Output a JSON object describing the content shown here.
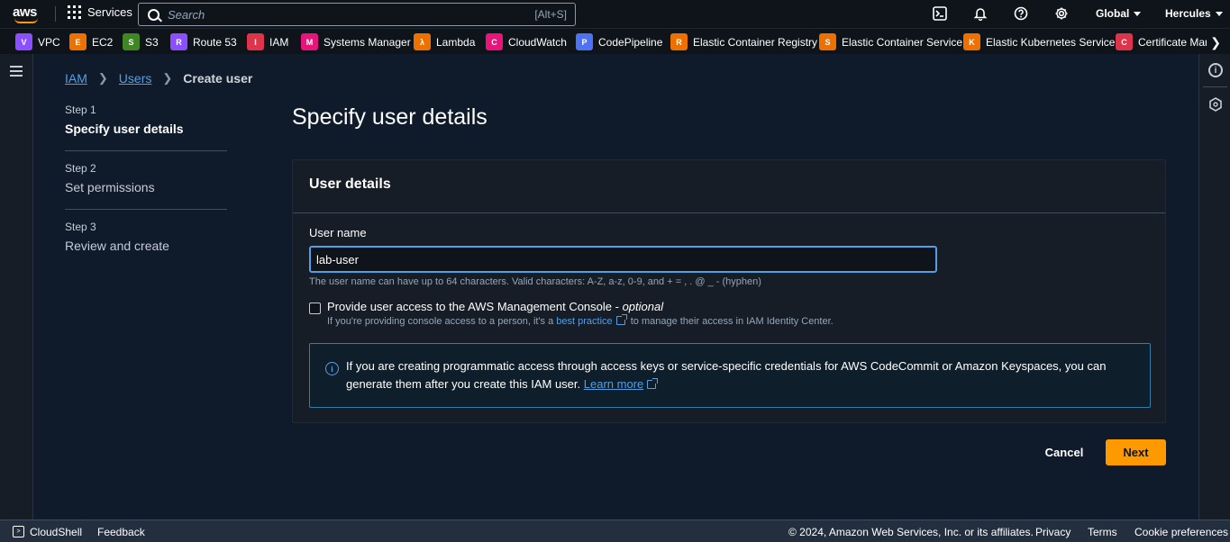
{
  "topnav": {
    "logo": "aws",
    "services_label": "Services",
    "search_placeholder": "Search",
    "search_shortcut": "[Alt+S]",
    "region": "Global",
    "account": "Hercules",
    "icons": [
      "cloudshell-icon",
      "bell-icon",
      "help-icon",
      "gear-icon"
    ]
  },
  "favorites": [
    {
      "label": "VPC",
      "color": "#8c4fff",
      "glyph": "V"
    },
    {
      "label": "EC2",
      "color": "#ed7100",
      "glyph": "E"
    },
    {
      "label": "S3",
      "color": "#3f8624",
      "glyph": "S"
    },
    {
      "label": "Route 53",
      "color": "#8c4fff",
      "glyph": "R"
    },
    {
      "label": "IAM",
      "color": "#dd344c",
      "glyph": "I"
    },
    {
      "label": "Systems Manager",
      "color": "#e7157b",
      "glyph": "M"
    },
    {
      "label": "Lambda",
      "color": "#ed7100",
      "glyph": "λ"
    },
    {
      "label": "CloudWatch",
      "color": "#e7157b",
      "glyph": "C"
    },
    {
      "label": "CodePipeline",
      "color": "#4d72f3",
      "glyph": "P"
    },
    {
      "label": "Elastic Container Registry",
      "color": "#ed7100",
      "glyph": "R"
    },
    {
      "label": "Elastic Container Service",
      "color": "#ed7100",
      "glyph": "S"
    },
    {
      "label": "Elastic Kubernetes Service",
      "color": "#ed7100",
      "glyph": "K"
    },
    {
      "label": "Certificate Man",
      "color": "#dd344c",
      "glyph": "C"
    }
  ],
  "breadcrumb": {
    "iam": "IAM",
    "users": "Users",
    "current": "Create user"
  },
  "steps": [
    {
      "num": "Step 1",
      "title": "Specify user details"
    },
    {
      "num": "Step 2",
      "title": "Set permissions"
    },
    {
      "num": "Step 3",
      "title": "Review and create"
    }
  ],
  "page_title": "Specify user details",
  "panel": {
    "header": "User details",
    "username_label": "User name",
    "username_value": "lab-user",
    "username_hint": "The user name can have up to 64 characters. Valid characters: A-Z, a-z, 0-9, and + = , . @ _ - (hyphen)",
    "console_label": "Provide user access to the AWS Management Console - ",
    "console_optional": "optional",
    "console_desc_pre": "If you're providing console access to a person, it's a ",
    "console_desc_link": "best practice",
    "console_desc_post": " to manage their access in IAM Identity Center.",
    "info_text": "If you are creating programmatic access through access keys or service-specific credentials for AWS CodeCommit or Amazon Keyspaces, you can generate them after you create this IAM user. ",
    "info_link": "Learn more"
  },
  "actions": {
    "cancel": "Cancel",
    "next": "Next"
  },
  "footer": {
    "cloudshell": "CloudShell",
    "feedback": "Feedback",
    "copyright": "© 2024, Amazon Web Services, Inc. or its affiliates.",
    "privacy": "Privacy",
    "terms": "Terms",
    "cookies": "Cookie preferences"
  }
}
